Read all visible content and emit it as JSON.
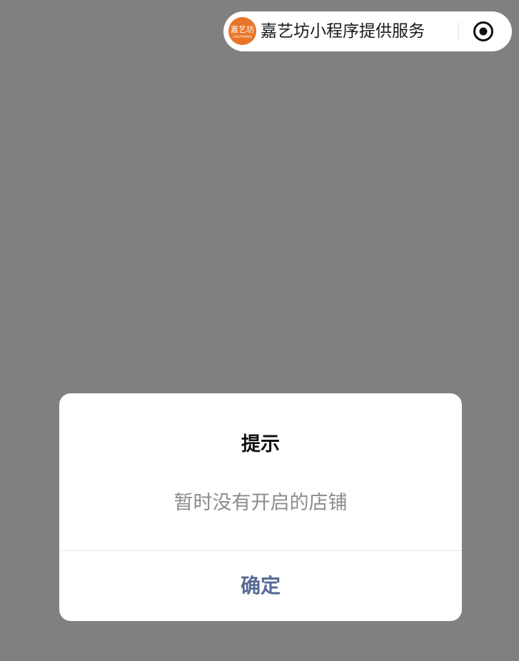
{
  "capsule": {
    "logo_text": "嘉艺坊",
    "logo_subtext": "CAIUYIFANG",
    "provider_text": "嘉艺坊小程序提供服务",
    "logo_color": "#e8752a"
  },
  "icons": {
    "target": "target-icon"
  },
  "dialog": {
    "title": "提示",
    "message": "暂时没有开启的店铺",
    "confirm_label": "确定",
    "confirm_color": "#576b95"
  },
  "colors": {
    "overlay": "#808080"
  }
}
